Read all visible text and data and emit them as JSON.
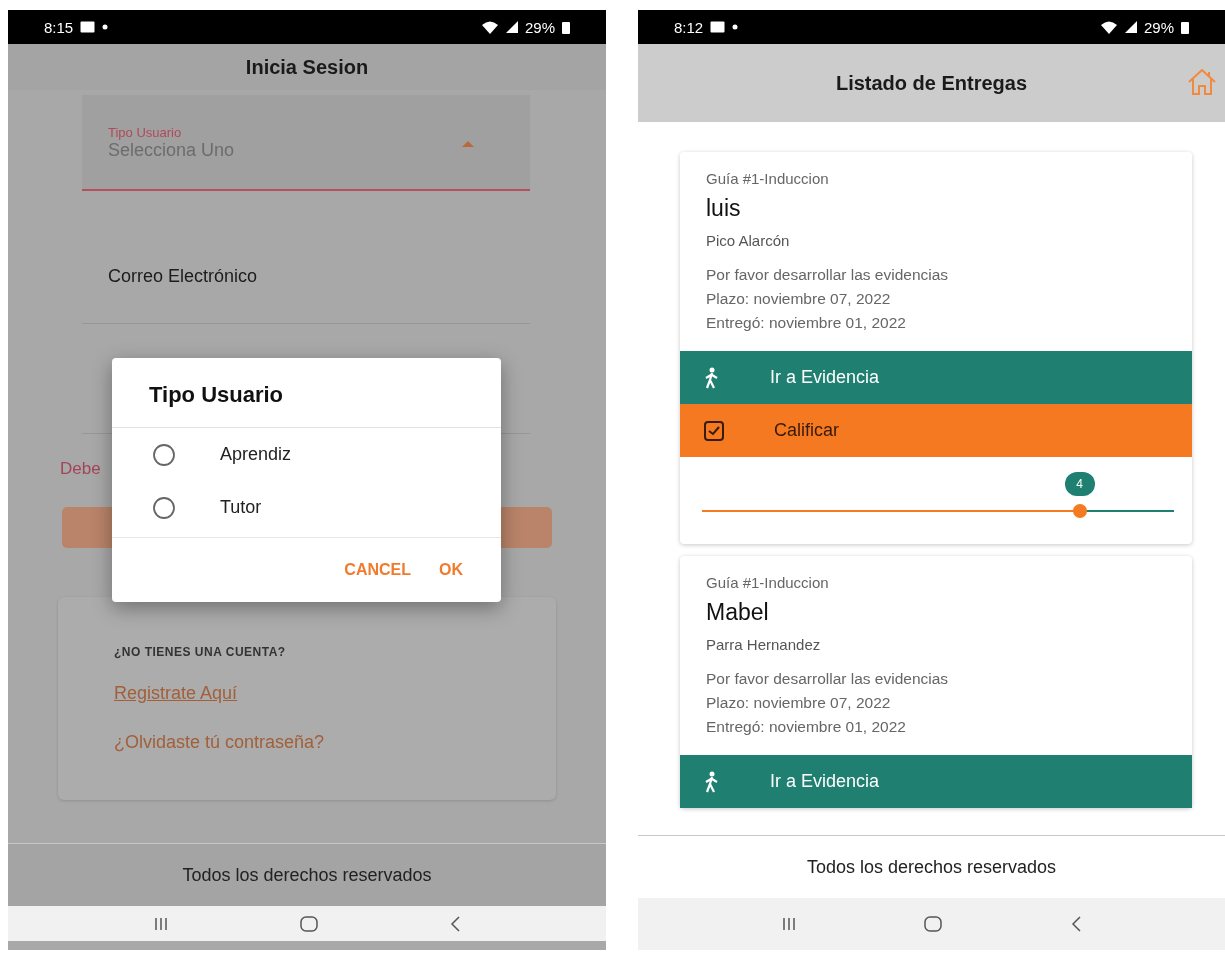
{
  "login_screen": {
    "status_bar": {
      "time": "8:15",
      "battery": "29%"
    },
    "title": "Inicia Sesion",
    "user_type_field": {
      "label": "Tipo Usuario",
      "placeholder": "Selecciona Uno"
    },
    "email_field": {
      "label": "Correo Electrónico"
    },
    "error_text": "Debe",
    "signup_card": {
      "question": "¿NO TIENES UNA CUENTA?",
      "register_link": "Registrate Aquí",
      "forgot_link": "¿Olvidaste tú contraseña?"
    },
    "footer": "Todos los derechos reservados",
    "dialog": {
      "title": "Tipo Usuario",
      "options": [
        {
          "label": "Aprendiz",
          "selected": false
        },
        {
          "label": "Tutor",
          "selected": false
        }
      ],
      "buttons": [
        "CANCEL",
        "OK"
      ]
    }
  },
  "deliveries_screen": {
    "status_bar": {
      "time": "8:12",
      "battery": "29%"
    },
    "title": "Listado de Entregas",
    "cards": [
      {
        "guide": "Guía #1-Induccion",
        "name": "luis",
        "surname": "Pico Alarcón",
        "lines": [
          "Por favor desarrollar las evidencias",
          "Plazo: noviembre 07, 2022",
          "Entregó: noviembre 01, 2022"
        ],
        "actions": [
          {
            "kind": "evidence",
            "label": "Ir a Evidencia"
          },
          {
            "kind": "grade",
            "label": "Calificar"
          }
        ],
        "grade": {
          "value": "4",
          "level": 0.8
        }
      },
      {
        "guide": "Guía #1-Induccion",
        "name": "Mabel",
        "surname": "Parra Hernandez",
        "lines": [
          "Por favor desarrollar las evidencias",
          "Plazo: noviembre 07, 2022",
          "Entregó: noviembre 01, 2022"
        ],
        "actions": [
          {
            "kind": "evidence",
            "label": "Ir a Evidencia"
          }
        ]
      }
    ],
    "footer": "Todos los derechos reservados"
  }
}
